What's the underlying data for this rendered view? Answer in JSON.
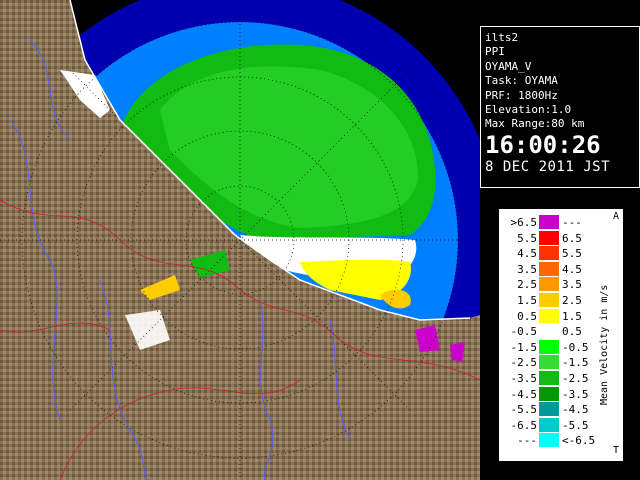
{
  "info": {
    "radar_id": "ilts2",
    "scan_type": "PPI",
    "product": "OYAMA_V",
    "task": "Task: OYAMA",
    "prf": "PRF: 1800Hz",
    "elevation": "Elevation:1.0",
    "max_range": "Max Range:80 km",
    "time": "16:00:26",
    "date": "8 DEC 2011 JST"
  },
  "legend": {
    "title": "Mean Velocity in m/s",
    "mark_top": "A",
    "mark_bottom": "T",
    "rows": [
      {
        "lo": ">6.5",
        "hi": "---",
        "color": "#cc00cc"
      },
      {
        "lo": "5.5",
        "hi": "6.5",
        "color": "#ff0000"
      },
      {
        "lo": "4.5",
        "hi": "5.5",
        "color": "#ff3300"
      },
      {
        "lo": "3.5",
        "hi": "4.5",
        "color": "#ff6600"
      },
      {
        "lo": "2.5",
        "hi": "3.5",
        "color": "#ff9900"
      },
      {
        "lo": "1.5",
        "hi": "2.5",
        "color": "#ffcc00"
      },
      {
        "lo": "0.5",
        "hi": "1.5",
        "color": "#ffff00"
      },
      {
        "lo": "-0.5",
        "hi": "0.5",
        "color": "#ffffff"
      },
      {
        "lo": "-1.5",
        "hi": "-0.5",
        "color": "#00ff00"
      },
      {
        "lo": "-2.5",
        "hi": "-1.5",
        "color": "#33dd33"
      },
      {
        "lo": "-3.5",
        "hi": "-2.5",
        "color": "#11bb11"
      },
      {
        "lo": "-4.5",
        "hi": "-3.5",
        "color": "#009900"
      },
      {
        "lo": "-5.5",
        "hi": "-4.5",
        "color": "#009999"
      },
      {
        "lo": "-6.5",
        "hi": "-5.5",
        "color": "#00cccc"
      },
      {
        "lo": "---",
        "hi": "<-6.5",
        "color": "#00ffff"
      }
    ]
  },
  "colors": {
    "background": "#000000",
    "range_ring_fill": "#0080ff",
    "range_ring_outer": "#0000b0",
    "land": "#8a7356",
    "approaching": "#00cc00",
    "receding": "#ffff00",
    "zero": "#ffffff"
  }
}
